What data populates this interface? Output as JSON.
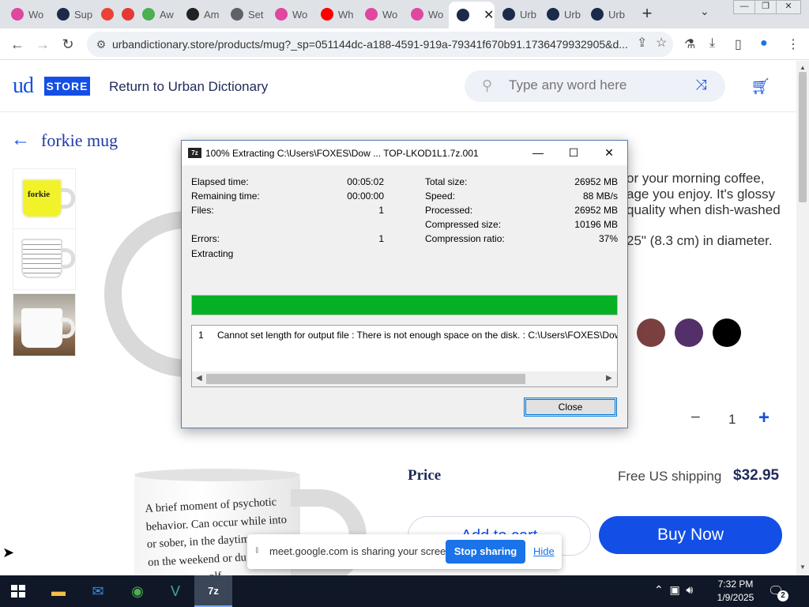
{
  "browser": {
    "tabs": [
      {
        "label": "Wo",
        "icon": "pinwheel-icon",
        "color": "#e0479e"
      },
      {
        "label": "Sup",
        "icon": "chat-icon",
        "color": "#1c2b4a"
      },
      {
        "label": "",
        "icon": "google-icon",
        "color": "#ea4335"
      },
      {
        "label": "",
        "icon": "record-icon",
        "color": "#e53935"
      },
      {
        "label": "Aw",
        "icon": "rainbow-icon",
        "color": "#4caf50"
      },
      {
        "label": "Am",
        "icon": "amazon-icon",
        "color": "#222222"
      },
      {
        "label": "Set",
        "icon": "gear-icon",
        "color": "#5f6368"
      },
      {
        "label": "Wo",
        "icon": "pinwheel-icon",
        "color": "#e0479e"
      },
      {
        "label": "Wh",
        "icon": "youtube-icon",
        "color": "#ff0000"
      },
      {
        "label": "Wo",
        "icon": "pinwheel-icon",
        "color": "#e0479e"
      },
      {
        "label": "Wo",
        "icon": "pinwheel-icon",
        "color": "#e0479e"
      },
      {
        "label": "",
        "icon": "ud-icon",
        "color": "#1c2b4a"
      },
      {
        "label": "Urb",
        "icon": "ud-icon",
        "color": "#1c2b4a"
      },
      {
        "label": "Urb",
        "icon": "ud-icon",
        "color": "#1c2b4a"
      },
      {
        "label": "Urb",
        "icon": "ud-icon",
        "color": "#1c2b4a"
      }
    ],
    "url": "urbandictionary.store/products/mug?_sp=051144dc-a188-4591-919a-79341f670b91.1736479932905&d..."
  },
  "store": {
    "logo_ud": "ud",
    "logo_store": "STORE",
    "return_link": "Return to Urban Dictionary",
    "search_placeholder": "Type any word here",
    "product_title": "forkie mug",
    "thumb1_text": "forkie",
    "description": "or your morning coffee,\nage you enjoy. It's glossy\nquality when dish-washed",
    "description2": "25\" (8.3 cm) in diameter.",
    "swatches": [
      "#7a4040",
      "#54306a",
      "#000000"
    ],
    "quantity": "1",
    "qty_minus": "−",
    "qty_plus": "+",
    "price_label": "Price",
    "shipping": "Free US shipping",
    "price": "$32.95",
    "add_to_cart": "Add to cart",
    "buy_now": "Buy Now",
    "mug_quote": "A brief moment of psychotic\nbehavior. Can occur while into\nor sober, in the daytim\non the weekend or du\n                 ... olf"
  },
  "dialog": {
    "app_icon": "7z",
    "title": "100% Extracting C:\\Users\\FOXES\\Dow ... TOP-LKOD1L1.7z.001",
    "left_stats": [
      {
        "label": "Elapsed time:",
        "value": "00:05:02"
      },
      {
        "label": "Remaining time:",
        "value": "00:00:00"
      },
      {
        "label": "Files:",
        "value": "1"
      },
      {
        "label": "Errors:",
        "value": "1"
      }
    ],
    "right_stats": [
      {
        "label": "Total size:",
        "value": "26952 MB"
      },
      {
        "label": "Speed:",
        "value": "88 MB/s"
      },
      {
        "label": "Processed:",
        "value": "26952 MB"
      },
      {
        "label": "Compressed size:",
        "value": "10196 MB"
      },
      {
        "label": "Compression ratio:",
        "value": "37%"
      }
    ],
    "status": "Extracting",
    "progress_percent": 100,
    "log_number": "1",
    "log_message": "Cannot set length for output file : There is not enough space on the disk. : C:\\Users\\FOXES\\Downloads\\DE",
    "close_label": "Close"
  },
  "share_bar": {
    "message": "meet.google.com is sharing your screen.",
    "stop_label": "Stop sharing",
    "hide_label": "Hide"
  },
  "taskbar": {
    "apps": [
      {
        "name": "file-explorer-icon",
        "glyph": "▬",
        "color": "#f5c042"
      },
      {
        "name": "mail-icon",
        "glyph": "✉",
        "color": "#3a8ee6"
      },
      {
        "name": "chrome-icon",
        "glyph": "◉",
        "color": "#4caf50"
      },
      {
        "name": "visual-studio-icon",
        "glyph": "V",
        "color": "#3fa7a0"
      },
      {
        "name": "7zip-icon",
        "glyph": "7z",
        "color": "#ffffff"
      }
    ],
    "time": "7:32 PM",
    "date": "1/9/2025",
    "notification_count": "2"
  }
}
